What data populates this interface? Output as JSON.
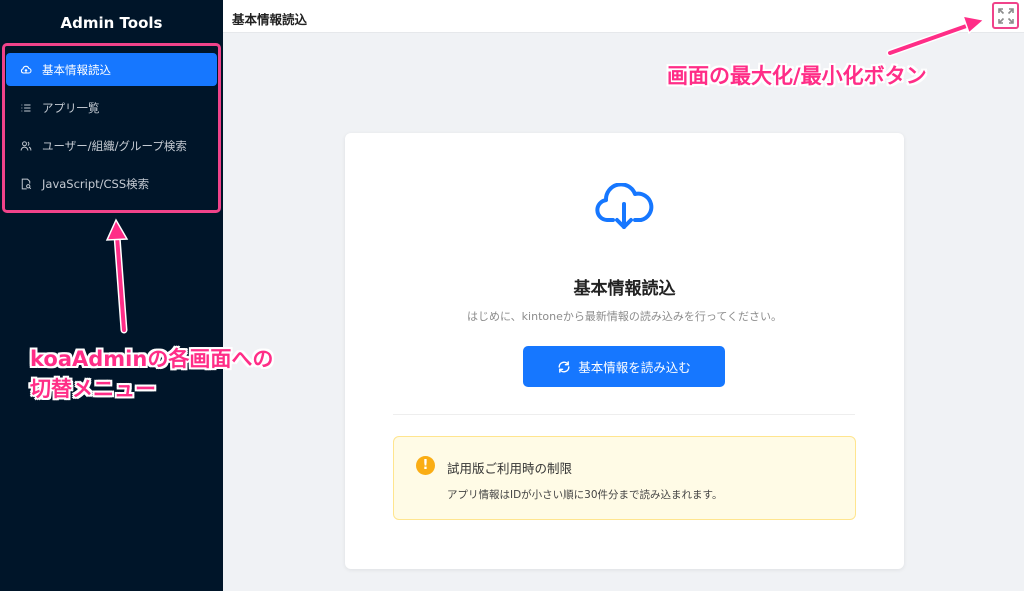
{
  "sidebar": {
    "brand": "Admin Tools",
    "items": [
      {
        "label": "基本情報読込",
        "icon": "cloud-icon",
        "active": true
      },
      {
        "label": "アプリ一覧",
        "icon": "list-icon",
        "active": false
      },
      {
        "label": "ユーザー/組織/グループ検索",
        "icon": "users-icon",
        "active": false
      },
      {
        "label": "JavaScript/CSS検索",
        "icon": "file-search-icon",
        "active": false
      }
    ]
  },
  "header": {
    "title": "基本情報読込",
    "maximize_icon": "fullscreen-icon"
  },
  "main": {
    "icon": "cloud-download-icon",
    "title": "基本情報読込",
    "subtitle": "はじめに、kintoneから最新情報の読み込みを行ってください。",
    "load_button": "基本情報を読み込む",
    "alert": {
      "title": "試用版ご利用時の制限",
      "description": "アプリ情報はIDが小さい順に30件分まで読み込まれます。"
    }
  },
  "annotations": {
    "maximize": "画面の最大化/最小化ボタン",
    "menu_line1": "koaAdminの各画面への",
    "menu_line2": "切替メニュー"
  },
  "colors": {
    "sidebar_bg": "#001529",
    "primary": "#1677ff",
    "annotation": "#ff2d87",
    "warning": "#faad14",
    "alert_bg": "#fffbe6"
  }
}
